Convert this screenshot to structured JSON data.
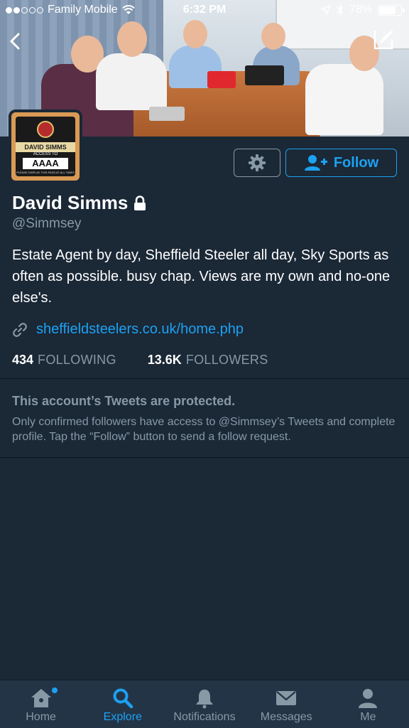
{
  "status_bar": {
    "carrier": "Family Mobile",
    "time": "6:32 PM",
    "battery": "78%",
    "battery_level": 0.78,
    "signal_bars": 2
  },
  "profile": {
    "display_name": "David Simms",
    "handle": "@Simmsey",
    "bio": "Estate Agent by day, Sheffield Steeler all day, Sky Sports as often as possible. busy chap. Views are my own and no-one else's.",
    "link": "sheffieldsteelers.co.uk/home.php",
    "following_count": "434",
    "following_label": "FOLLOWING",
    "followers_count": "13.6K",
    "followers_label": "FOLLOWERS",
    "protected": true,
    "avatar_badge": {
      "name": "DAVID SIMMS",
      "access": "ACCESS TO",
      "level": "AAAA",
      "note": "PLEASE DISPLAY THIS PASS AT ALL TIMES"
    }
  },
  "actions": {
    "follow_label": "Follow"
  },
  "protected_notice": {
    "title": "This account’s Tweets are protected.",
    "text": "Only confirmed followers have access to @Simmsey’s Tweets and complete profile. Tap the “Follow” button to send a follow request."
  },
  "tabs": [
    {
      "label": "Home",
      "icon": "home-icon",
      "active": false,
      "badge": true
    },
    {
      "label": "Explore",
      "icon": "search-icon",
      "active": true,
      "badge": false
    },
    {
      "label": "Notifications",
      "icon": "bell-icon",
      "active": false,
      "badge": false
    },
    {
      "label": "Messages",
      "icon": "envelope-icon",
      "active": false,
      "badge": false
    },
    {
      "label": "Me",
      "icon": "person-icon",
      "active": false,
      "badge": false
    }
  ],
  "colors": {
    "background": "#1b2836",
    "accent": "#1da1f2",
    "muted_text": "#8899a6",
    "tabbar": "#243447"
  }
}
